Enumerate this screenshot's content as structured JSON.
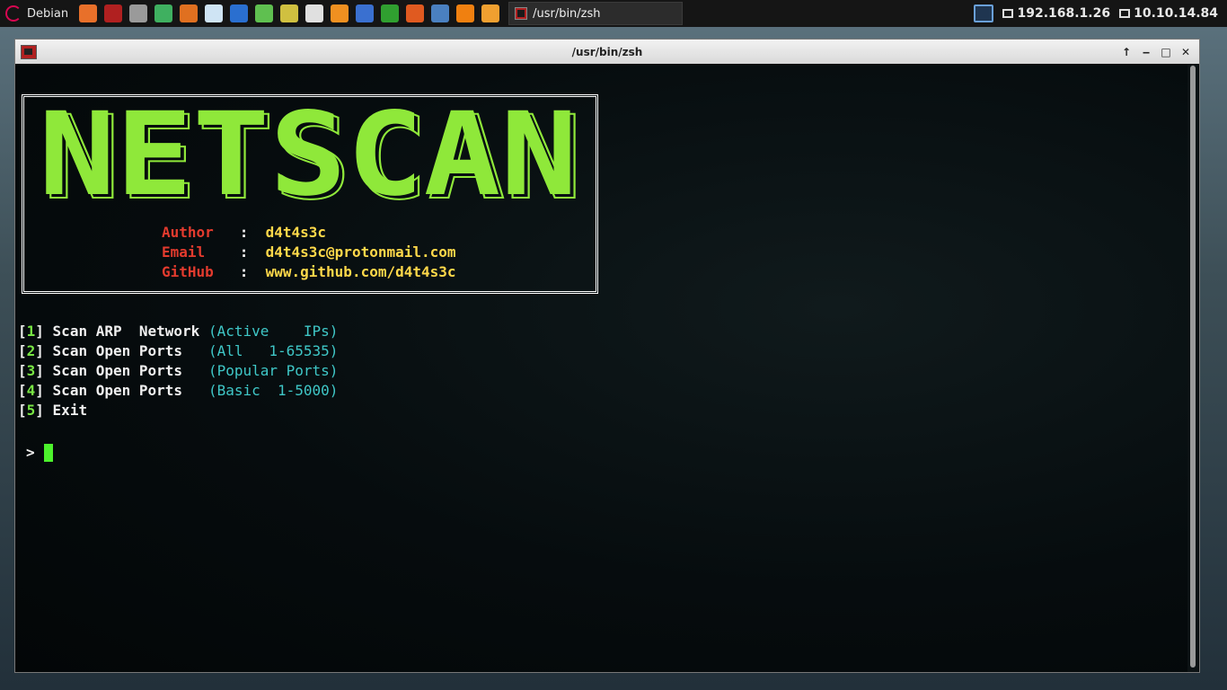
{
  "panel": {
    "start_label": "Debian",
    "launchers": [
      {
        "icon": "firefox-icon",
        "color": "#e8702a"
      },
      {
        "icon": "terminal-icon",
        "color": "#b02020"
      },
      {
        "icon": "file-manager-icon",
        "color": "#9a9a9a"
      },
      {
        "icon": "network-tool-icon",
        "color": "#3fb060"
      },
      {
        "icon": "burp-icon",
        "color": "#e07020"
      },
      {
        "icon": "eye-icon",
        "color": "#cfe4f4"
      },
      {
        "icon": "shark-fin-icon",
        "color": "#2a6fd0"
      },
      {
        "icon": "kali-dragon-icon",
        "color": "#5fc050"
      },
      {
        "icon": "network-config-icon",
        "color": "#d0c040"
      },
      {
        "icon": "text-editor-icon",
        "color": "#e0e0e0"
      },
      {
        "icon": "sublime-icon",
        "color": "#f09020"
      },
      {
        "icon": "document-icon",
        "color": "#3a70d0"
      },
      {
        "icon": "spreadsheet-icon",
        "color": "#30a030"
      },
      {
        "icon": "presentation-icon",
        "color": "#e05a20"
      },
      {
        "icon": "globe-icon",
        "color": "#4a80c0"
      },
      {
        "icon": "vlc-icon",
        "color": "#f08010"
      },
      {
        "icon": "search-icon",
        "color": "#f0a030"
      }
    ],
    "task_title": "/usr/bin/zsh",
    "ip1": "192.168.1.26",
    "ip2": "10.10.14.84"
  },
  "window": {
    "title": "/usr/bin/zsh",
    "buttons": [
      "↑",
      "‒",
      "□",
      "✕"
    ]
  },
  "banner": {
    "logo_text": "NETSCAN",
    "logo_color": "#8fe83a",
    "author_label": "Author",
    "author_value": "d4t4s3c",
    "email_label": "Email",
    "email_value": "d4t4s3c@protonmail.com",
    "github_label": "GitHub",
    "github_value": "www.github.com/d4t4s3c",
    "separator": ":"
  },
  "menu": [
    {
      "num": "1",
      "label": "Scan ARP  Network ",
      "desc": "(Active    IPs)"
    },
    {
      "num": "2",
      "label": "Scan Open Ports   ",
      "desc": "(All   1-65535)"
    },
    {
      "num": "3",
      "label": "Scan Open Ports   ",
      "desc": "(Popular Ports)"
    },
    {
      "num": "4",
      "label": "Scan Open Ports   ",
      "desc": "(Basic  1-5000)"
    },
    {
      "num": "5",
      "label": "Exit",
      "desc": ""
    }
  ],
  "prompt": {
    "symbol": ">"
  }
}
